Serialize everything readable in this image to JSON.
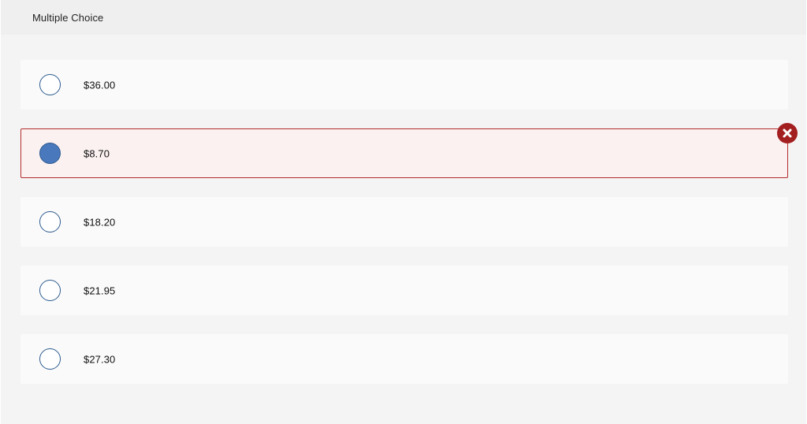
{
  "header": {
    "title": "Multiple Choice"
  },
  "options": [
    {
      "label": "$36.00",
      "selected": false
    },
    {
      "label": "$8.70",
      "selected": true,
      "status": "incorrect"
    },
    {
      "label": "$18.20",
      "selected": false
    },
    {
      "label": "$21.95",
      "selected": false
    },
    {
      "label": "$27.30",
      "selected": false
    }
  ],
  "colors": {
    "incorrect_border": "#b32c2c",
    "incorrect_bg": "#fcf1f1",
    "radio_fill_selected": "#4a78bd",
    "radio_border": "#2d5b8f",
    "incorrect_icon_bg": "#a31f1f"
  },
  "icons": {
    "incorrect": "close-circle-icon"
  }
}
